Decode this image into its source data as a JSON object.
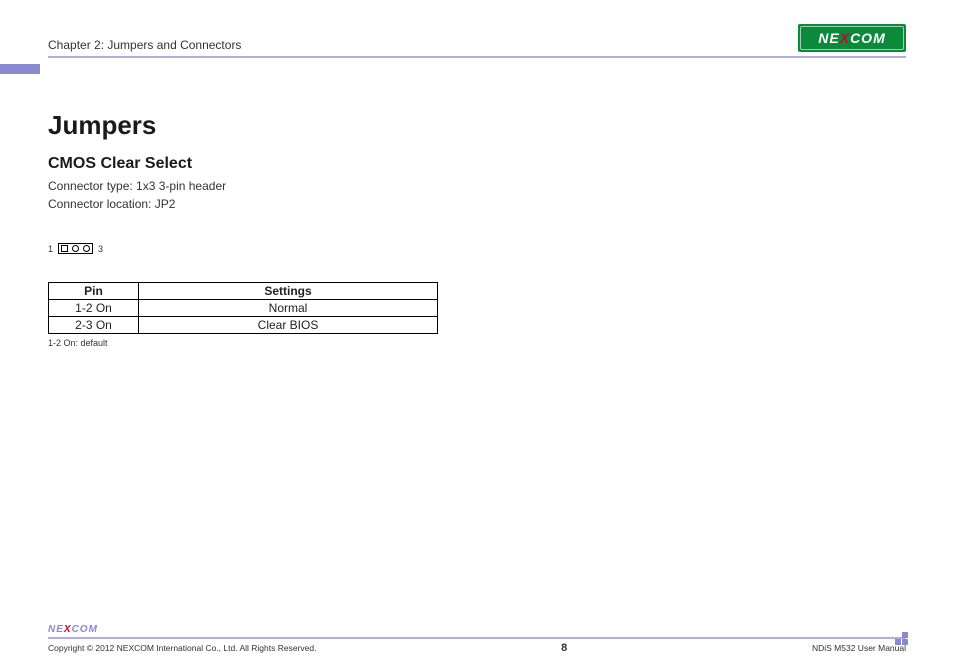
{
  "header": {
    "chapter": "Chapter 2: Jumpers and Connectors",
    "logo_text_left": "NE",
    "logo_text_x": "X",
    "logo_text_right": "COM"
  },
  "content": {
    "title": "Jumpers",
    "subtitle": "CMOS Clear Select",
    "connector_type": "Connector type: 1x3 3-pin header",
    "connector_location": "Connector location: JP2",
    "pin_left": "1",
    "pin_right": "3",
    "table": {
      "headers": {
        "pin": "Pin",
        "settings": "Settings"
      },
      "rows": [
        {
          "pin": "1-2 On",
          "settings": "Normal"
        },
        {
          "pin": "2-3 On",
          "settings": "Clear BIOS"
        }
      ]
    },
    "note": "1-2 On: default"
  },
  "footer": {
    "logo_left": "NE",
    "logo_x": "X",
    "logo_right": "COM",
    "copyright": "Copyright © 2012 NEXCOM International Co., Ltd. All Rights Reserved.",
    "page": "8",
    "manual": "NDiS M532 User Manual"
  }
}
